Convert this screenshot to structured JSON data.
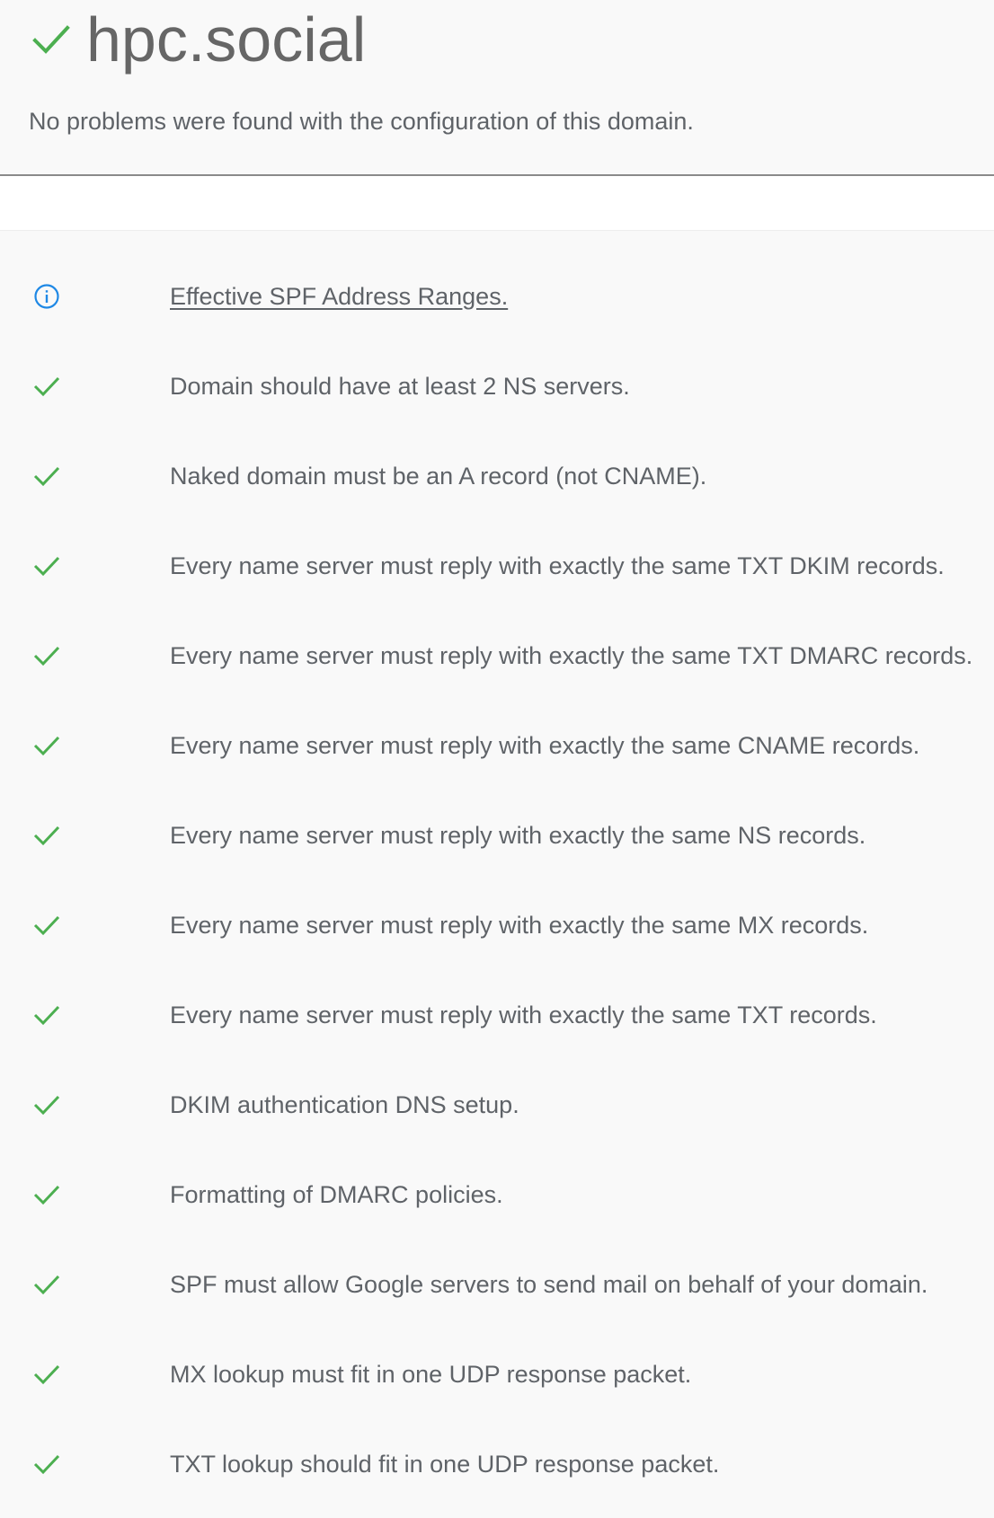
{
  "header": {
    "domain": "hpc.social",
    "status_icon": "check-icon",
    "summary": "No problems were found with the configuration of this domain."
  },
  "colors": {
    "check": "#4caf50",
    "info": "#1e88e5",
    "text": "#5f6368"
  },
  "checks": [
    {
      "icon": "info-icon",
      "label": "Effective SPF Address Ranges.",
      "link": true
    },
    {
      "icon": "check-icon",
      "label": "Domain should have at least 2 NS servers."
    },
    {
      "icon": "check-icon",
      "label": "Naked domain must be an A record (not CNAME)."
    },
    {
      "icon": "check-icon",
      "label": "Every name server must reply with exactly the same TXT DKIM records."
    },
    {
      "icon": "check-icon",
      "label": "Every name server must reply with exactly the same TXT DMARC records."
    },
    {
      "icon": "check-icon",
      "label": "Every name server must reply with exactly the same CNAME records."
    },
    {
      "icon": "check-icon",
      "label": "Every name server must reply with exactly the same NS records."
    },
    {
      "icon": "check-icon",
      "label": "Every name server must reply with exactly the same MX records."
    },
    {
      "icon": "check-icon",
      "label": "Every name server must reply with exactly the same TXT records."
    },
    {
      "icon": "check-icon",
      "label": "DKIM authentication DNS setup."
    },
    {
      "icon": "check-icon",
      "label": "Formatting of DMARC policies."
    },
    {
      "icon": "check-icon",
      "label": "SPF must allow Google servers to send mail on behalf of your domain."
    },
    {
      "icon": "check-icon",
      "label": "MX lookup must fit in one UDP response packet."
    },
    {
      "icon": "check-icon",
      "label": "TXT lookup should fit in one UDP response packet."
    }
  ]
}
